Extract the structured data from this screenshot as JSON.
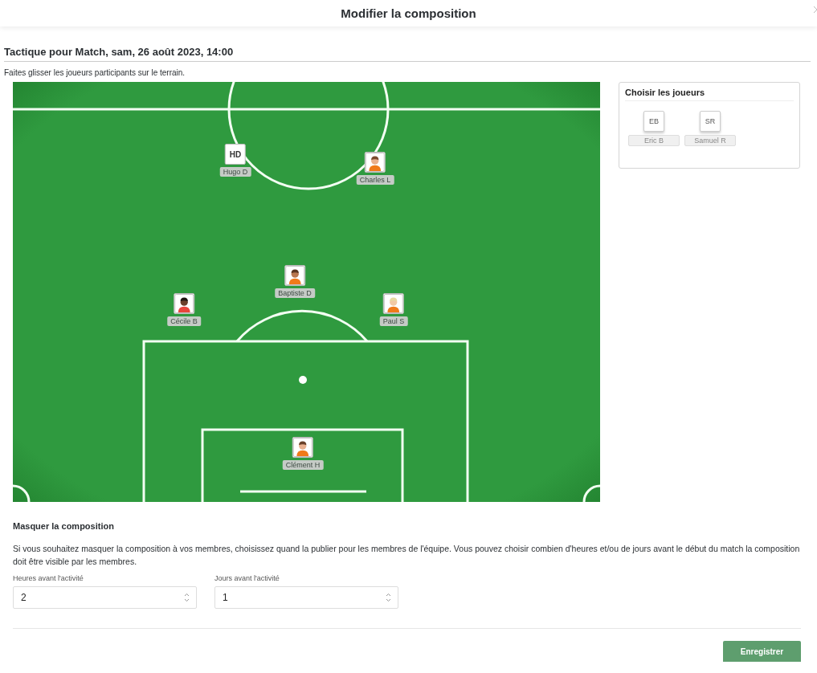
{
  "dialog": {
    "title": "Modifier la composition"
  },
  "section_title": "Tactique pour Match, sam, 26 août 2023, 14:00",
  "instruction": "Faites glisser les joueurs participants sur le terrain.",
  "pitch_players": [
    {
      "name": "Hugo D",
      "kind": "initials",
      "initials": "HD"
    },
    {
      "name": "Charles L",
      "kind": "avatar"
    },
    {
      "name": "Baptiste D",
      "kind": "avatar"
    },
    {
      "name": "Cécile B",
      "kind": "avatar"
    },
    {
      "name": "Paul S",
      "kind": "avatar"
    },
    {
      "name": "Clément H",
      "kind": "avatar"
    }
  ],
  "bench": {
    "title": "Choisir les joueurs",
    "players": [
      {
        "initials": "EB",
        "name": "Eric B"
      },
      {
        "initials": "SR",
        "name": "Samuel R"
      }
    ]
  },
  "hide_section": {
    "title": "Masquer la composition",
    "description": "Si vous souhaitez masquer la composition à vos membres, choisissez quand la publier pour les membres de l'équipe. Vous pouvez choisir combien d'heures et/ou de jours avant le début du match la composition doit être visible par les membres.",
    "fields": [
      {
        "label": "Heures avant l'activité",
        "value": "2"
      },
      {
        "label": "Jours avant l'activité",
        "value": "1"
      }
    ]
  },
  "save_button": "Enregistrer"
}
